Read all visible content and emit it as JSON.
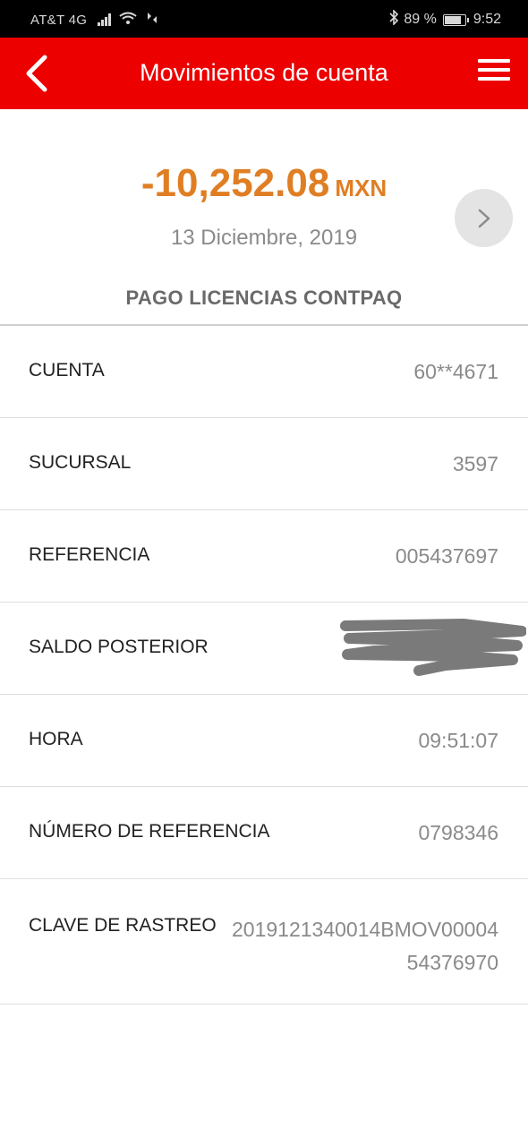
{
  "status_bar": {
    "carrier": "AT&T 4G",
    "battery_percent": "89 %",
    "battery_level": 0.89,
    "time": "9:52"
  },
  "header": {
    "title": "Movimientos de cuenta",
    "back_icon": "chevron-left-icon",
    "menu_icon": "hamburger-menu-icon"
  },
  "transaction": {
    "amount": "-10,252.08",
    "currency": "MXN",
    "date": "13 Diciembre, 2019",
    "concept": "PAGO LICENCIAS CONTPAQ",
    "next_icon": "chevron-right-icon"
  },
  "details": [
    {
      "label": "CUENTA",
      "value": "60**4671"
    },
    {
      "label": "SUCURSAL",
      "value": "3597"
    },
    {
      "label": "REFERENCIA",
      "value": "005437697"
    },
    {
      "label": "SALDO POSTERIOR",
      "value": ""
    },
    {
      "label": "HORA",
      "value": "09:51:07"
    },
    {
      "label": "NÚMERO DE REFERENCIA",
      "value": "0798346"
    },
    {
      "label": "CLAVE DE RASTREO",
      "value_line1": "2019121340014BMOV00004",
      "value_line2": "54376970"
    }
  ],
  "colors": {
    "header_red": "#ec0000",
    "amount_orange": "#e07e24",
    "value_gray": "#8a8a8a"
  }
}
